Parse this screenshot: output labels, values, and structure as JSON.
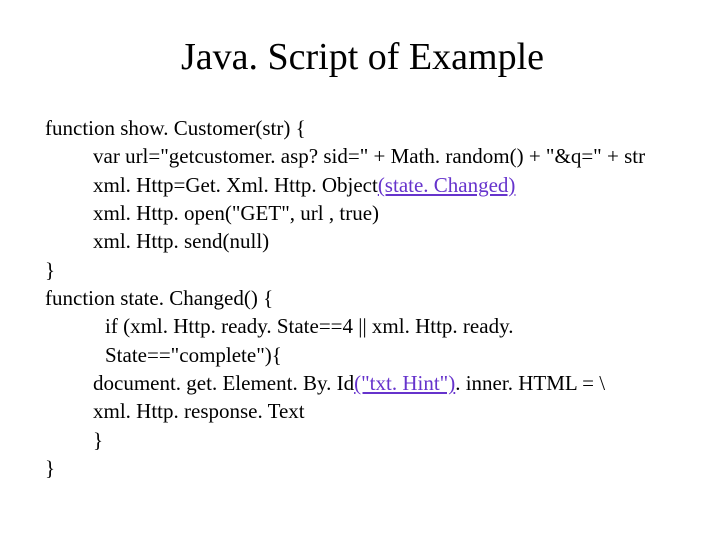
{
  "title": "Java. Script of Example",
  "code": {
    "l1": "function show. Customer(str) {",
    "l2": "var url=\"getcustomer. asp? sid=\" + Math. random() + \"&q=\" + str",
    "l3a": "xml. Http=Get. Xml. Http. Object",
    "l3b": "(state. Changed)",
    "l4": "xml. Http. open(\"GET\", url , true)",
    "l5": "xml. Http. send(null)",
    "l6": "}",
    "l7": "function state. Changed() {",
    "l8": "if (xml. Http. ready. State==4 || xml. Http. ready. State==\"complete\"){",
    "l9a": "document. get. Element. By. Id",
    "l9b": "(\"txt. Hint\")",
    "l9c": ". inner. HTML = \\",
    "l10": "xml. Http. response. Text",
    "l11": "}",
    "l12": "}"
  }
}
